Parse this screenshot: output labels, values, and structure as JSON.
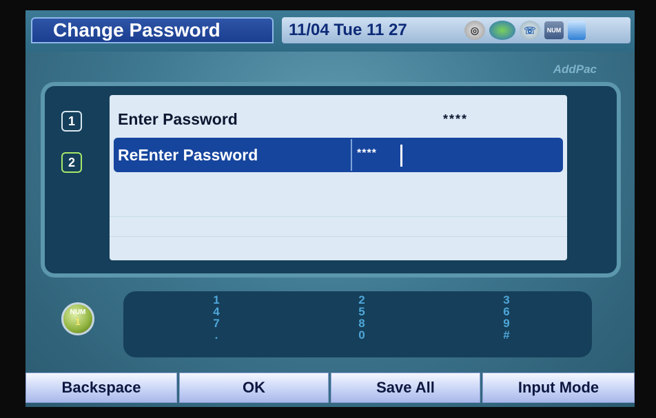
{
  "header": {
    "title": "Change Password",
    "datetime": "11/04 Tue 11 27",
    "status_icons": [
      {
        "name": "network-status-icon",
        "text": ""
      },
      {
        "name": "globe-icon",
        "text": ""
      },
      {
        "name": "phone-icon",
        "text": ""
      },
      {
        "name": "num-lock-icon",
        "text": "NUM"
      },
      {
        "name": "computer-icon",
        "text": ""
      }
    ]
  },
  "brand": "AddPac",
  "form": {
    "rows": [
      {
        "index": "1",
        "label": "Enter Password",
        "value": "****"
      },
      {
        "index": "2",
        "label": "ReEnter Password",
        "value": "****"
      }
    ]
  },
  "input_mode": {
    "line1": "NUM",
    "line2": "1"
  },
  "keypad": {
    "columns": [
      [
        "1",
        "4",
        "7",
        "."
      ],
      [
        "2",
        "5",
        "8",
        "0"
      ],
      [
        "3",
        "6",
        "9",
        "#"
      ]
    ]
  },
  "softkeys": {
    "backspace": "Backspace",
    "ok": "OK",
    "save_all": "Save All",
    "input_mode": "Input Mode"
  },
  "colors": {
    "selected_row": "#16459e",
    "title_tab": "#1a3d8f",
    "keypad_digits": "#4fa6d8"
  }
}
